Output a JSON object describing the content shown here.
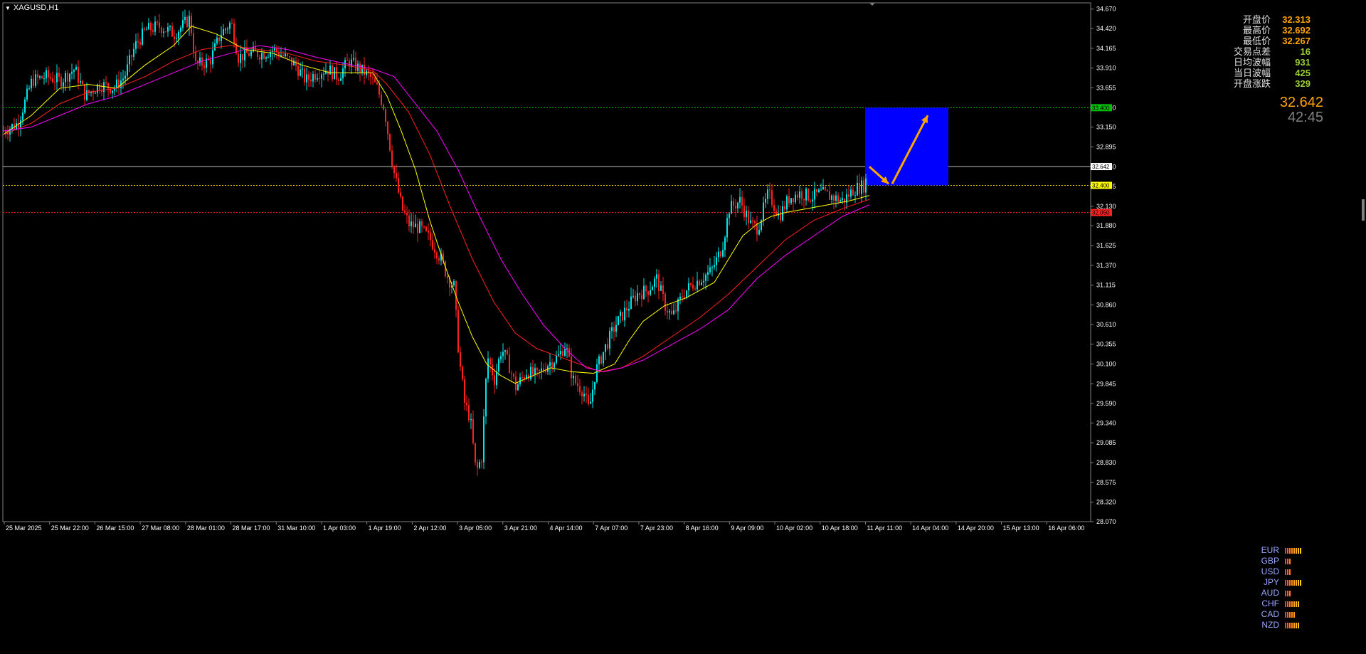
{
  "symbol": "XAGUSD,H1",
  "info_panel": [
    {
      "label": "开盘价",
      "value": "32.313",
      "color": "orange"
    },
    {
      "label": "最高价",
      "value": "32.692",
      "color": "orange"
    },
    {
      "label": "最低价",
      "value": "32.267",
      "color": "orange"
    },
    {
      "label": "交易点差",
      "value": "16",
      "color": "green"
    },
    {
      "label": "日均波幅",
      "value": "931",
      "color": "green"
    },
    {
      "label": "当日波幅",
      "value": "425",
      "color": "green"
    },
    {
      "label": "开盘涨跌",
      "value": "329",
      "color": "green"
    }
  ],
  "current_price": "32.642",
  "countdown": "42:45",
  "currency_strength": [
    {
      "ccy": "EUR",
      "bars": 8
    },
    {
      "ccy": "GBP",
      "bars": 3
    },
    {
      "ccy": "USD",
      "bars": 3
    },
    {
      "ccy": "JPY",
      "bars": 8
    },
    {
      "ccy": "AUD",
      "bars": 3
    },
    {
      "ccy": "CHF",
      "bars": 7
    },
    {
      "ccy": "CAD",
      "bars": 5
    },
    {
      "ccy": "NZD",
      "bars": 7
    }
  ],
  "chart_data": {
    "type": "candlestick",
    "instrument": "XAGUSD",
    "timeframe": "H1",
    "ylim": [
      28.07,
      34.75
    ],
    "y_ticks": [
      "34.670",
      "34.420",
      "34.165",
      "33.910",
      "33.655",
      "33.400",
      "33.150",
      "32.895",
      "32.640",
      "32.385",
      "32.130",
      "31.880",
      "31.625",
      "31.370",
      "31.115",
      "30.860",
      "30.610",
      "30.355",
      "30.100",
      "29.845",
      "29.590",
      "29.340",
      "29.085",
      "28.830",
      "28.575",
      "28.320",
      "28.070"
    ],
    "x_ticks": [
      "25 Mar 2025",
      "25 Mar 22:00",
      "26 Mar 15:00",
      "27 Mar 08:00",
      "28 Mar 01:00",
      "28 Mar 17:00",
      "31 Mar 10:00",
      "1 Apr 03:00",
      "1 Apr 19:00",
      "2 Apr 12:00",
      "3 Apr 05:00",
      "3 Apr 21:00",
      "4 Apr 14:00",
      "7 Apr 07:00",
      "7 Apr 23:00",
      "8 Apr 16:00",
      "9 Apr 09:00",
      "10 Apr 02:00",
      "10 Apr 18:00",
      "11 Apr 11:00",
      "14 Apr 04:00",
      "14 Apr 20:00",
      "15 Apr 13:00",
      "16 Apr 06:00"
    ],
    "price_path": [
      [
        0,
        33.1
      ],
      [
        20,
        33.2
      ],
      [
        40,
        33.75
      ],
      [
        60,
        33.8
      ],
      [
        80,
        33.75
      ],
      [
        100,
        33.9
      ],
      [
        115,
        33.55
      ],
      [
        135,
        33.7
      ],
      [
        155,
        33.65
      ],
      [
        170,
        33.8
      ],
      [
        185,
        34.2
      ],
      [
        200,
        34.4
      ],
      [
        220,
        34.45
      ],
      [
        240,
        34.35
      ],
      [
        262,
        34.55
      ],
      [
        270,
        33.95
      ],
      [
        290,
        34.0
      ],
      [
        305,
        34.35
      ],
      [
        320,
        34.5
      ],
      [
        330,
        34.05
      ],
      [
        345,
        34.1
      ],
      [
        365,
        34.1
      ],
      [
        380,
        34.15
      ],
      [
        395,
        34.05
      ],
      [
        410,
        33.95
      ],
      [
        425,
        33.75
      ],
      [
        440,
        33.85
      ],
      [
        455,
        33.9
      ],
      [
        470,
        33.8
      ],
      [
        485,
        34.0
      ],
      [
        500,
        33.9
      ],
      [
        515,
        33.8
      ],
      [
        525,
        33.65
      ],
      [
        535,
        33.4
      ],
      [
        548,
        32.6
      ],
      [
        560,
        32.1
      ],
      [
        570,
        31.9
      ],
      [
        585,
        31.85
      ],
      [
        600,
        31.7
      ],
      [
        615,
        31.45
      ],
      [
        625,
        31.2
      ],
      [
        633,
        31.1
      ],
      [
        640,
        30.2
      ],
      [
        648,
        29.6
      ],
      [
        656,
        29.4
      ],
      [
        664,
        28.7
      ],
      [
        672,
        28.9
      ],
      [
        680,
        30.2
      ],
      [
        690,
        29.9
      ],
      [
        700,
        30.3
      ],
      [
        710,
        30.1
      ],
      [
        720,
        29.8
      ],
      [
        735,
        30.0
      ],
      [
        750,
        29.95
      ],
      [
        765,
        30.1
      ],
      [
        780,
        30.2
      ],
      [
        790,
        30.35
      ],
      [
        800,
        29.9
      ],
      [
        815,
        29.75
      ],
      [
        823,
        29.5
      ],
      [
        832,
        30.0
      ],
      [
        845,
        30.3
      ],
      [
        860,
        30.6
      ],
      [
        875,
        30.8
      ],
      [
        890,
        31.0
      ],
      [
        905,
        31.05
      ],
      [
        918,
        31.2
      ],
      [
        930,
        30.85
      ],
      [
        940,
        30.7
      ],
      [
        955,
        31.0
      ],
      [
        965,
        31.1
      ],
      [
        980,
        31.2
      ],
      [
        995,
        31.3
      ],
      [
        1010,
        31.6
      ],
      [
        1020,
        32.1
      ],
      [
        1035,
        32.2
      ],
      [
        1050,
        31.9
      ],
      [
        1060,
        31.85
      ],
      [
        1075,
        32.3
      ],
      [
        1090,
        32.0
      ],
      [
        1105,
        32.25
      ],
      [
        1120,
        32.3
      ],
      [
        1135,
        32.25
      ],
      [
        1150,
        32.3
      ],
      [
        1165,
        32.25
      ],
      [
        1180,
        32.2
      ],
      [
        1195,
        32.35
      ],
      [
        1210,
        32.4
      ],
      [
        1218,
        32.64
      ]
    ],
    "moving_averages": [
      {
        "color": "#ffff00",
        "points": [
          [
            0,
            33.05
          ],
          [
            40,
            33.3
          ],
          [
            80,
            33.65
          ],
          [
            120,
            33.7
          ],
          [
            160,
            33.65
          ],
          [
            200,
            33.95
          ],
          [
            240,
            34.2
          ],
          [
            265,
            34.45
          ],
          [
            300,
            34.35
          ],
          [
            340,
            34.15
          ],
          [
            380,
            34.1
          ],
          [
            420,
            33.95
          ],
          [
            460,
            33.85
          ],
          [
            500,
            33.85
          ],
          [
            520,
            33.85
          ],
          [
            540,
            33.55
          ],
          [
            560,
            33.1
          ],
          [
            580,
            32.6
          ],
          [
            600,
            31.95
          ],
          [
            620,
            31.4
          ],
          [
            640,
            30.9
          ],
          [
            660,
            30.45
          ],
          [
            680,
            30.1
          ],
          [
            700,
            29.95
          ],
          [
            720,
            29.85
          ],
          [
            745,
            29.95
          ],
          [
            770,
            30.05
          ],
          [
            800,
            30.0
          ],
          [
            830,
            29.98
          ],
          [
            860,
            30.1
          ],
          [
            880,
            30.4
          ],
          [
            900,
            30.65
          ],
          [
            930,
            30.85
          ],
          [
            960,
            30.95
          ],
          [
            1000,
            31.15
          ],
          [
            1020,
            31.45
          ],
          [
            1040,
            31.75
          ],
          [
            1060,
            31.9
          ],
          [
            1080,
            32.0
          ],
          [
            1100,
            32.05
          ],
          [
            1130,
            32.1
          ],
          [
            1160,
            32.15
          ],
          [
            1190,
            32.2
          ],
          [
            1218,
            32.27
          ]
        ]
      },
      {
        "color": "#ff2020",
        "points": [
          [
            0,
            33.05
          ],
          [
            40,
            33.2
          ],
          [
            80,
            33.45
          ],
          [
            120,
            33.6
          ],
          [
            160,
            33.65
          ],
          [
            200,
            33.8
          ],
          [
            240,
            34.0
          ],
          [
            280,
            34.15
          ],
          [
            320,
            34.2
          ],
          [
            360,
            34.15
          ],
          [
            400,
            34.1
          ],
          [
            440,
            34.0
          ],
          [
            480,
            33.95
          ],
          [
            520,
            33.88
          ],
          [
            540,
            33.7
          ],
          [
            570,
            33.35
          ],
          [
            600,
            32.8
          ],
          [
            630,
            32.1
          ],
          [
            660,
            31.45
          ],
          [
            690,
            30.9
          ],
          [
            720,
            30.5
          ],
          [
            750,
            30.3
          ],
          [
            780,
            30.2
          ],
          [
            810,
            30.1
          ],
          [
            840,
            30.0
          ],
          [
            870,
            30.05
          ],
          [
            900,
            30.2
          ],
          [
            940,
            30.45
          ],
          [
            980,
            30.7
          ],
          [
            1020,
            31.0
          ],
          [
            1060,
            31.35
          ],
          [
            1100,
            31.7
          ],
          [
            1140,
            31.95
          ],
          [
            1180,
            32.1
          ],
          [
            1218,
            32.22
          ]
        ]
      },
      {
        "color": "#ff00ff",
        "points": [
          [
            0,
            33.1
          ],
          [
            40,
            33.15
          ],
          [
            80,
            33.3
          ],
          [
            120,
            33.45
          ],
          [
            160,
            33.55
          ],
          [
            200,
            33.7
          ],
          [
            240,
            33.85
          ],
          [
            280,
            34.0
          ],
          [
            320,
            34.1
          ],
          [
            360,
            34.2
          ],
          [
            400,
            34.15
          ],
          [
            440,
            34.05
          ],
          [
            480,
            33.97
          ],
          [
            520,
            33.9
          ],
          [
            550,
            33.8
          ],
          [
            580,
            33.45
          ],
          [
            610,
            33.1
          ],
          [
            640,
            32.6
          ],
          [
            670,
            32.0
          ],
          [
            700,
            31.45
          ],
          [
            730,
            31.0
          ],
          [
            760,
            30.6
          ],
          [
            790,
            30.3
          ],
          [
            820,
            30.05
          ],
          [
            845,
            30.0
          ],
          [
            870,
            30.05
          ],
          [
            900,
            30.15
          ],
          [
            940,
            30.35
          ],
          [
            980,
            30.55
          ],
          [
            1020,
            30.8
          ],
          [
            1060,
            31.2
          ],
          [
            1100,
            31.5
          ],
          [
            1140,
            31.75
          ],
          [
            1180,
            32.0
          ],
          [
            1218,
            32.15
          ]
        ]
      }
    ],
    "horizontal_lines": [
      {
        "price": 33.4,
        "color": "#00c000",
        "style": "dotted",
        "label": "33.400",
        "label_bg": "#00c000"
      },
      {
        "price": 32.642,
        "color": "#c0c0c0",
        "style": "solid",
        "label": "32.642",
        "label_bg": "#ffffff"
      },
      {
        "price": 32.4,
        "color": "#e8c800",
        "style": "dotted",
        "label": "32.400",
        "label_bg": "#ffff00"
      },
      {
        "price": 32.05,
        "color": "#ff2020",
        "style": "dotted",
        "label": "32.050",
        "label_bg": "#ff2020"
      }
    ],
    "target_box": {
      "price_top": 33.4,
      "price_bottom": 32.4,
      "color": "#0000ff"
    },
    "arrows": [
      {
        "from": [
          1218,
          32.64
        ],
        "to": [
          1245,
          32.42
        ],
        "color": "#ffa500"
      },
      {
        "from": [
          1250,
          32.42
        ],
        "to": [
          1300,
          33.3
        ],
        "color": "#ffa500"
      }
    ]
  }
}
